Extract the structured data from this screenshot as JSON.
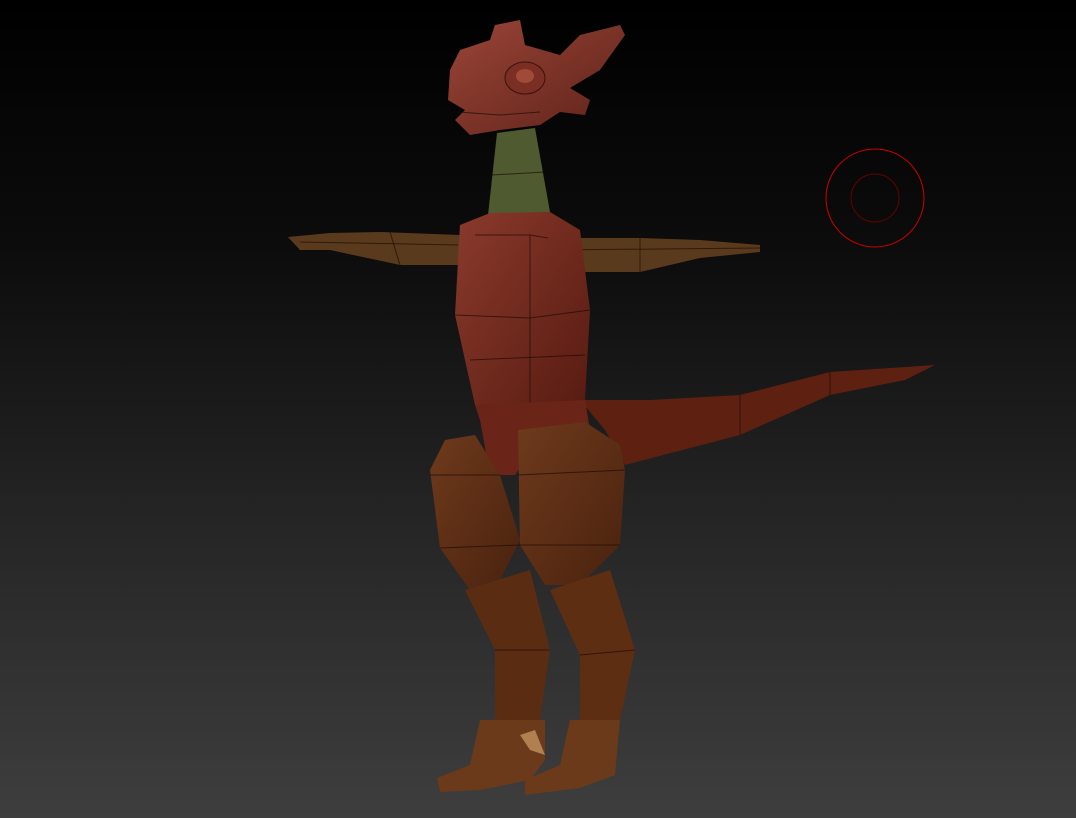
{
  "viewport": {
    "background_top": "#000000",
    "background_bottom": "#3e3e3e"
  },
  "model": {
    "colors": {
      "head": "#7a3228",
      "neck": "#4f5a30",
      "torso": "#6a2418",
      "arms": "#5a3a1c",
      "tail": "#5e2010",
      "legs": "#5a2e14",
      "feet": "#6a3a1a"
    }
  },
  "cursor": {
    "icon": "brush-circle-icon",
    "color": "#cc0000"
  }
}
